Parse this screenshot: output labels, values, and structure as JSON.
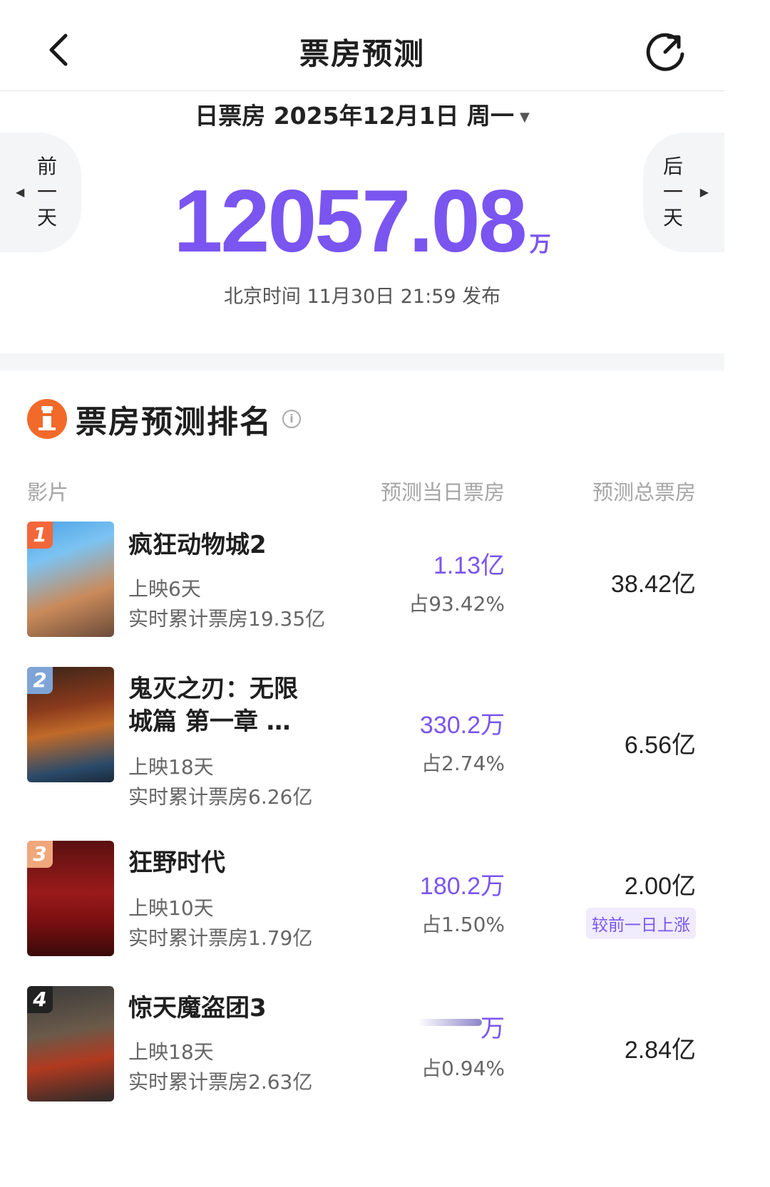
{
  "header": {
    "title": "票房预测"
  },
  "date_selector": {
    "label": "日票房 2025年12月1日 周一",
    "caret": "▼"
  },
  "prev_day": {
    "label": "前\n一\n天",
    "arrow": "◀"
  },
  "next_day": {
    "label": "后\n一\n天",
    "arrow": "▶"
  },
  "summary": {
    "value": "12057.08",
    "unit": "万",
    "publish_time": "北京时间 11月30日 21:59 发布",
    "value_color": "#7a55f0"
  },
  "ranking": {
    "title": "票房预测排名",
    "info_icon": "i",
    "columns": [
      "影片",
      "预测当日票房",
      "预测总票房"
    ],
    "movies": [
      {
        "rank": "1",
        "title": "疯狂动物城2",
        "days": "上映6天",
        "cumulative": "实时累计票房19.35亿",
        "today": "1.13亿",
        "share": "占93.42%",
        "total": "38.42亿",
        "badge": "",
        "rank_color": "#f2673a"
      },
      {
        "rank": "2",
        "title": "鬼灭之刃：无限\n城篇 第一章 …",
        "days": "上映18天",
        "cumulative": "实时累计票房6.26亿",
        "today": "330.2万",
        "share": "占2.74%",
        "total": "6.56亿",
        "badge": "",
        "rank_color": "#7ea4d6"
      },
      {
        "rank": "3",
        "title": "狂野时代",
        "days": "上映10天",
        "cumulative": "实时累计票房1.79亿",
        "today": "180.2万",
        "share": "占1.50%",
        "total": "2.00亿",
        "badge": "较前一日上涨",
        "rank_color": "#f0a77c"
      },
      {
        "rank": "4",
        "title": "惊天魔盗团3",
        "days": "上映18天",
        "cumulative": "实时累计票房2.63亿",
        "today": "万",
        "share": "占0.94%",
        "total": "2.84亿",
        "badge": "",
        "rank_color": "#222222"
      }
    ]
  }
}
